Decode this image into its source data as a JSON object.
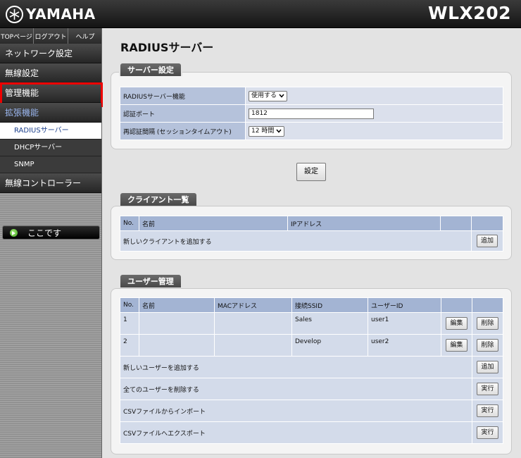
{
  "header": {
    "brand": "YAMAHA",
    "model": "WLX202"
  },
  "topnav": [
    "TOPページ",
    "ログアウト",
    "ヘルプ"
  ],
  "sidebar": {
    "items": [
      {
        "label": "ネットワーク設定"
      },
      {
        "label": "無線設定"
      },
      {
        "label": "管理機能"
      },
      {
        "label": "拡張機能"
      }
    ],
    "subitems": [
      {
        "label": "RADIUSサーバー"
      },
      {
        "label": "DHCPサーバー"
      },
      {
        "label": "SNMP"
      }
    ],
    "controller": "無線コントローラー",
    "here": "ここです"
  },
  "page_title": "RADIUSサーバー",
  "server": {
    "title": "サーバー設定",
    "rows": [
      {
        "label": "RADIUSサーバー機能",
        "value": "使用する"
      },
      {
        "label": "認証ポート",
        "value": "1812"
      },
      {
        "label": "再認証間隔 (セッションタイムアウト)",
        "value": "12 時間"
      }
    ],
    "submit": "設定"
  },
  "clients": {
    "title": "クライアント一覧",
    "headers": [
      "No.",
      "名前",
      "IPアドレス"
    ],
    "add_label": "新しいクライアントを追加する",
    "add_button": "追加"
  },
  "users": {
    "title": "ユーザー管理",
    "headers": [
      "No.",
      "名前",
      "MACアドレス",
      "接続SSID",
      "ユーザーID"
    ],
    "rows": [
      {
        "no": "1",
        "ssid": "Sales",
        "userid": "user1",
        "edit": "編集",
        "delete": "削除"
      },
      {
        "no": "2",
        "ssid": "Develop",
        "userid": "user2",
        "edit": "編集",
        "delete": "削除"
      }
    ],
    "actions": [
      {
        "label": "新しいユーザーを追加する",
        "button": "追加"
      },
      {
        "label": "全てのユーザーを削除する",
        "button": "実行"
      },
      {
        "label": "CSVファイルからインポート",
        "button": "実行"
      },
      {
        "label": "CSVファイルへエクスポート",
        "button": "実行"
      }
    ]
  }
}
